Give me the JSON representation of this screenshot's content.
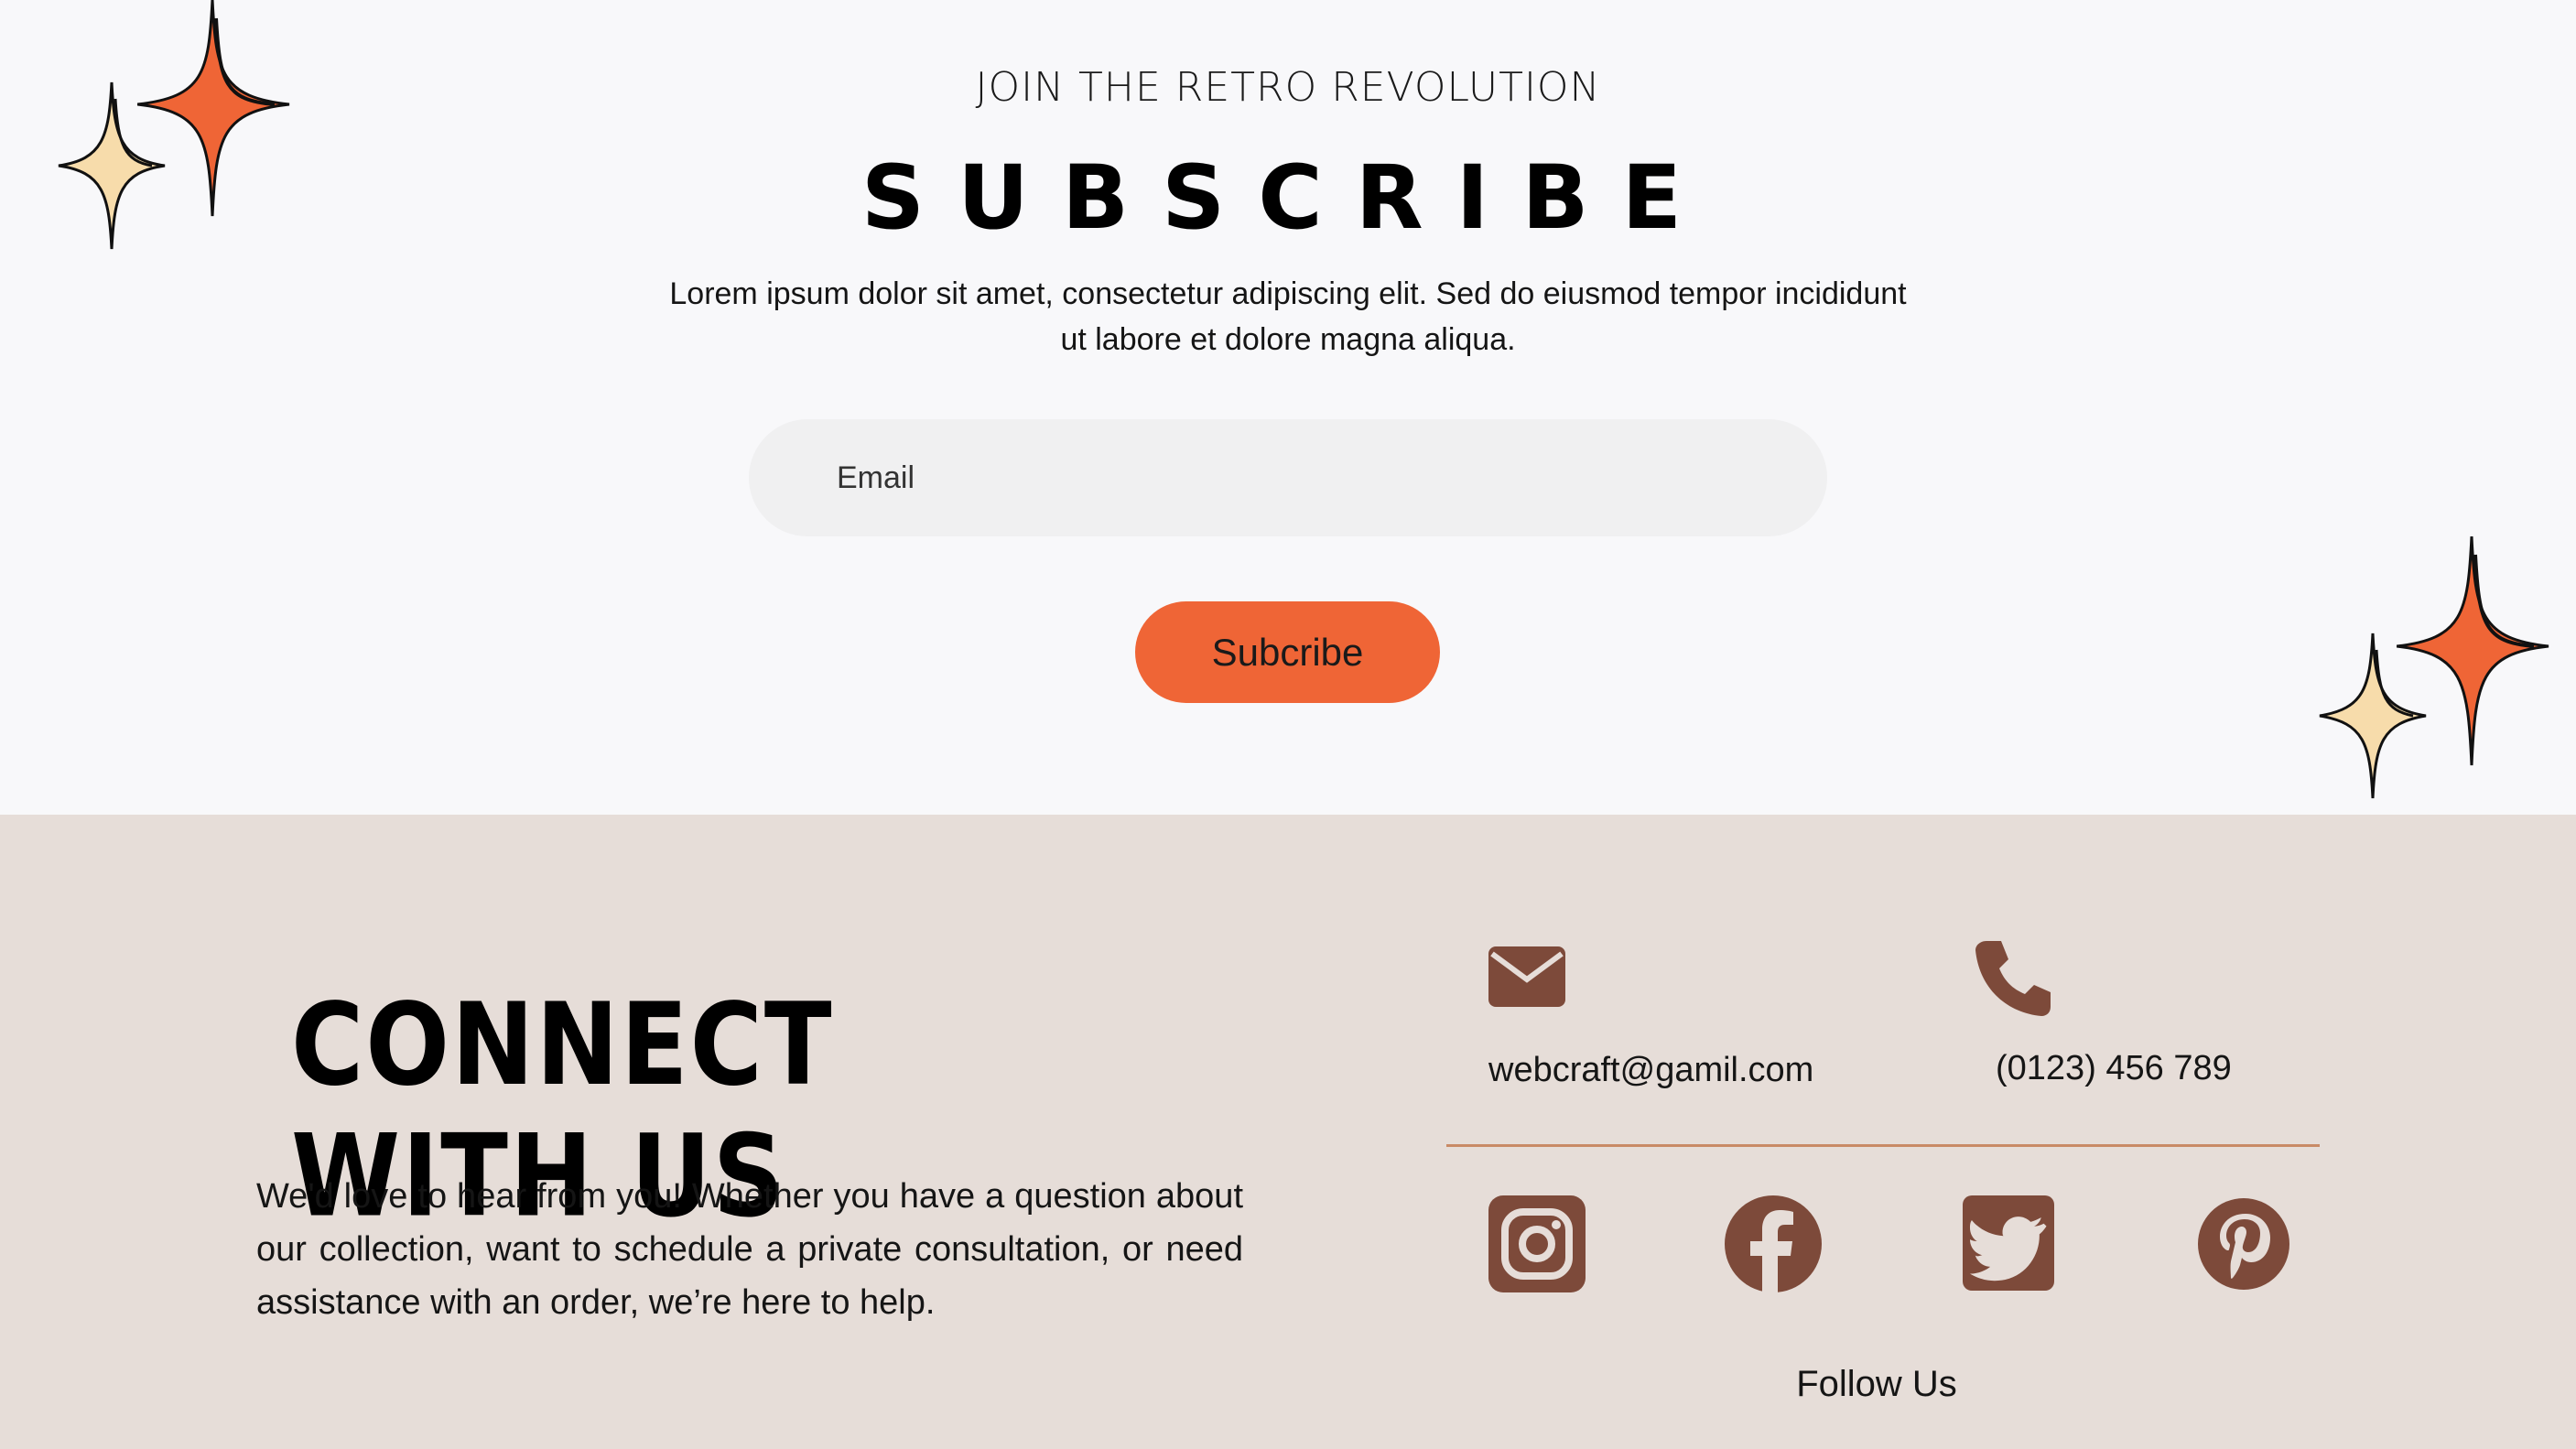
{
  "subscribe": {
    "eyebrow": "JOIN THE RETRO REVOLUTION",
    "title": "SUBSCRIBE",
    "description": "Lorem ipsum dolor sit amet, consectetur adipiscing elit. Sed do eiusmod tempor incididunt ut labore et dolore magna aliqua.",
    "email_placeholder": "Email",
    "button_label": "Subcribe"
  },
  "connect": {
    "title": "CONNECT WITH US",
    "text": "We'd love to hear from you! Whether you have a question about our collection, want to schedule a private consultation, or need assistance with an order, we’re here to help.",
    "email": "webcraft@gamil.com",
    "phone": "(0123) 456 789",
    "follow_label": "Follow Us",
    "socials": [
      {
        "icon": "instagram-icon"
      },
      {
        "icon": "facebook-icon"
      },
      {
        "icon": "twitter-icon"
      },
      {
        "icon": "pinterest-icon"
      }
    ]
  },
  "colors": {
    "accent": "#ef6536",
    "cream": "#f7dcab",
    "brown": "#7d4a3a",
    "footer_bg": "#e6ddd8",
    "page_bg": "#f8f8fa"
  }
}
